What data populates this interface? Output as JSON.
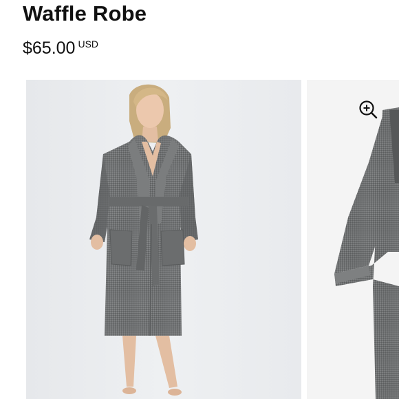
{
  "product": {
    "title": "Waffle Robe",
    "price": "$65.00",
    "currency": "USD"
  },
  "gallery": {
    "images": [
      {
        "name": "model-wearing-robe-photo"
      },
      {
        "name": "robe-flat-product-photo"
      }
    ],
    "zoom_icon": "zoom-in-icon"
  },
  "colors": {
    "text": "#111111",
    "robe": "#6f7172",
    "photo_background": "#eceef1"
  }
}
